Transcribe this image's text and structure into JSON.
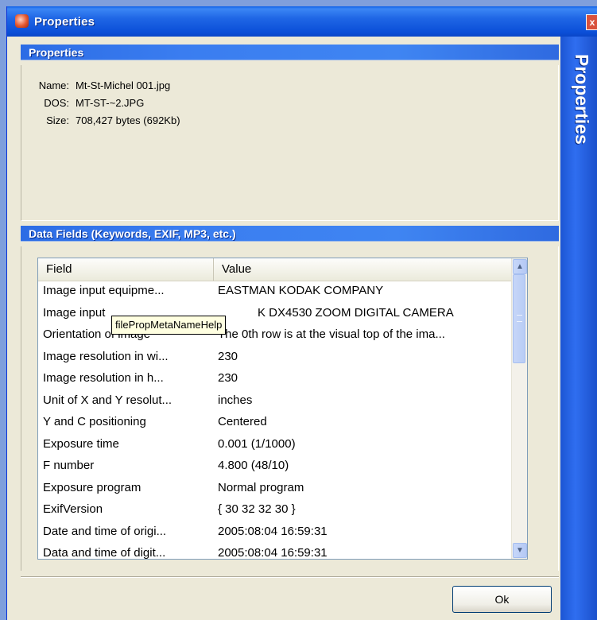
{
  "window": {
    "title": "Properties",
    "side_banner": "Properties",
    "close_glyph": "x"
  },
  "properties_section": {
    "header": "Properties",
    "fields": [
      {
        "label": "Name:",
        "value": "Mt-St-Michel 001.jpg"
      },
      {
        "label": "DOS:",
        "value": "MT-ST-~2.JPG"
      },
      {
        "label": "Size:",
        "value": "708,427 bytes (692Kb)"
      }
    ]
  },
  "data_fields_section": {
    "header": "Data Fields (Keywords, EXIF, MP3, etc.)",
    "columns": [
      "Field",
      "Value"
    ],
    "rows": [
      {
        "field": "Image input equipme...",
        "value": "EASTMAN KODAK COMPANY"
      },
      {
        "field": "Image input",
        "value": "K DX4530 ZOOM DIGITAL CAMERA"
      },
      {
        "field": "Orientation of image",
        "value": "The 0th row is at the visual top of the ima..."
      },
      {
        "field": "Image resolution in wi...",
        "value": "230"
      },
      {
        "field": "Image resolution in h...",
        "value": "230"
      },
      {
        "field": "Unit of X and Y resolut...",
        "value": "inches"
      },
      {
        "field": "Y and C positioning",
        "value": "Centered"
      },
      {
        "field": "Exposure time",
        "value": "0.001 (1/1000)"
      },
      {
        "field": "F number",
        "value": "4.800 (48/10)"
      },
      {
        "field": "Exposure program",
        "value": "Normal program"
      },
      {
        "field": "ExifVersion",
        "value": "{ 30 32 32 30 }"
      },
      {
        "field": "Date and time of origi...",
        "value": "2005:08:04 16:59:31"
      },
      {
        "field": "Data and time of digit...",
        "value": "2005:08:04 16:59:31"
      }
    ],
    "tooltip": "filePropMetaNameHelp"
  },
  "buttons": {
    "ok": "Ok"
  },
  "icons": {
    "scroll_up": "▲",
    "scroll_down": "▼"
  }
}
